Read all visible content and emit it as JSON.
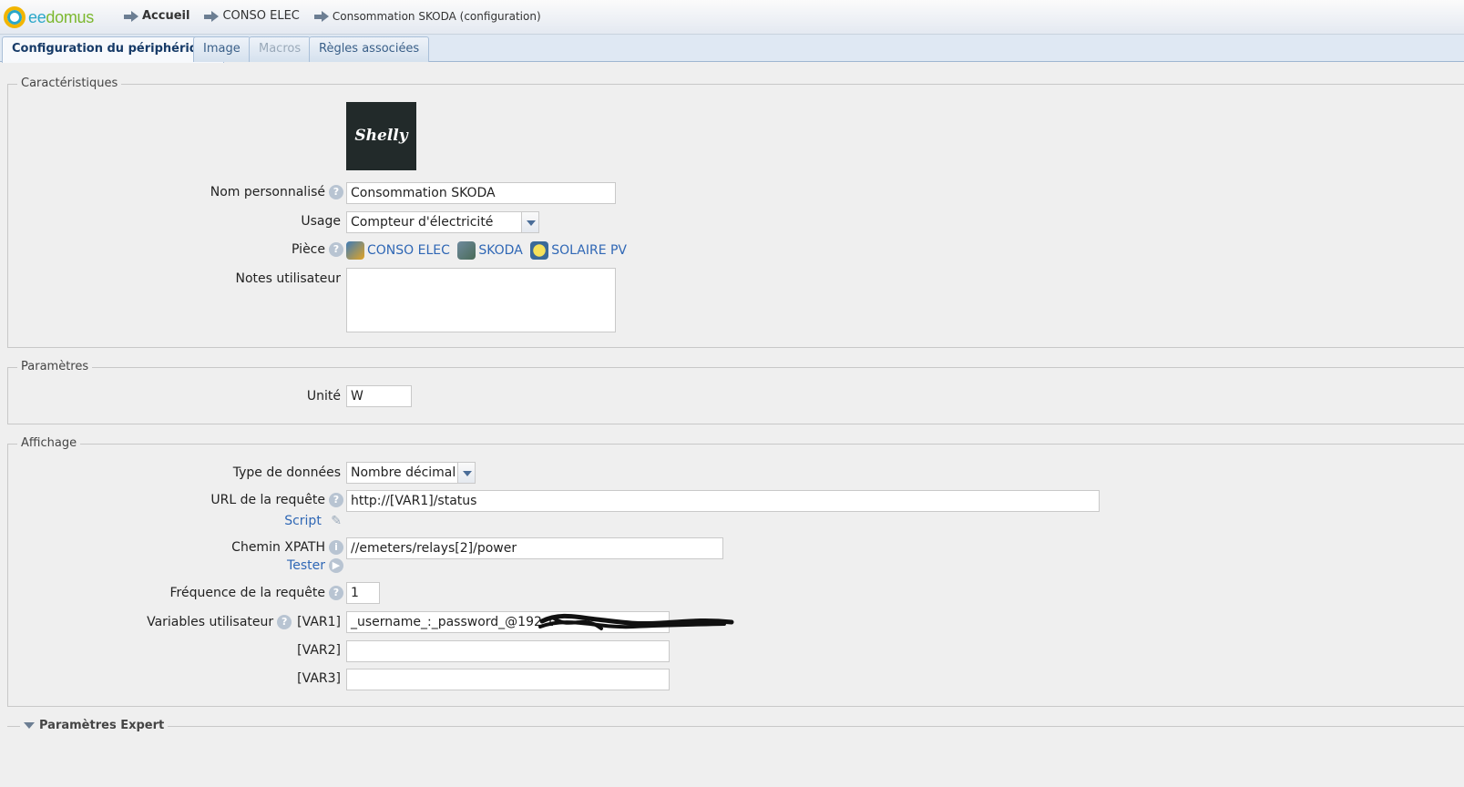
{
  "app": {
    "logo_a": "ee",
    "logo_b": "domus"
  },
  "breadcrumb": [
    {
      "label": "Accueil"
    },
    {
      "label": "CONSO ELEC"
    },
    {
      "label": "Consommation SKODA (configuration)"
    }
  ],
  "tabs": [
    {
      "label": "Configuration du périphérique",
      "state": "active"
    },
    {
      "label": "Image",
      "state": "normal"
    },
    {
      "label": "Macros",
      "state": "disabled"
    },
    {
      "label": "Règles associées",
      "state": "normal"
    }
  ],
  "caracteristiques": {
    "legend": "Caractéristiques",
    "device_image_text": "Shelly",
    "nom_label": "Nom personnalisé",
    "nom_value": "Consommation SKODA",
    "usage_label": "Usage",
    "usage_value": "Compteur d'électricité",
    "piece_label": "Pièce",
    "pieces": [
      "CONSO ELEC",
      "SKODA",
      "SOLAIRE PV"
    ],
    "notes_label": "Notes utilisateur",
    "notes_value": ""
  },
  "parametres": {
    "legend": "Paramètres",
    "unite_label": "Unité",
    "unite_value": "W"
  },
  "affichage": {
    "legend": "Affichage",
    "type_label": "Type de données",
    "type_value": "Nombre décimal",
    "url_label": "URL de la requête",
    "url_value": "http://[VAR1]/status",
    "script_link": "Script",
    "xpath_label": "Chemin XPATH",
    "xpath_value": "//emeters/relays[2]/power",
    "tester_link": "Tester",
    "freq_label": "Fréquence de la requête",
    "freq_value": "1",
    "vars_label": "Variables utilisateur",
    "var1_label": "[VAR1]",
    "var1_value": "_username_:_password_@192.1",
    "var2_label": "[VAR2]",
    "var2_value": "",
    "var3_label": "[VAR3]",
    "var3_value": ""
  },
  "expert": {
    "label": "Paramètres Expert"
  },
  "colors": {
    "tab_active_text": "#173b68",
    "link": "#2f67b5",
    "accent": "#2aa7c9"
  }
}
